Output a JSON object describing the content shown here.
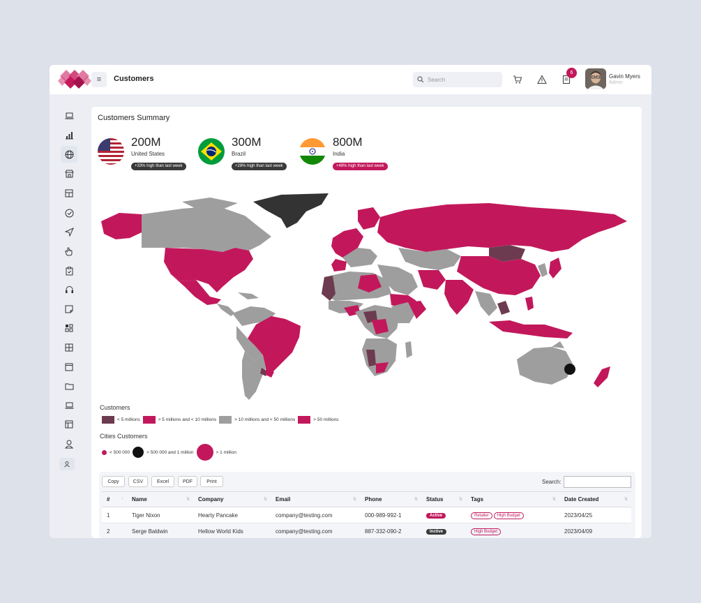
{
  "header": {
    "title": "Customers",
    "search_placeholder": "Search",
    "notification_count": "6",
    "user_name": "Gavin Myers",
    "user_role": "Admin"
  },
  "sidebar": {
    "items": [
      {
        "icon": "laptop-icon"
      },
      {
        "icon": "bar-chart-icon"
      },
      {
        "icon": "globe-icon",
        "active": true
      },
      {
        "icon": "store-icon"
      },
      {
        "icon": "calculator-icon"
      },
      {
        "icon": "check-circle-icon"
      },
      {
        "icon": "send-icon"
      },
      {
        "icon": "hand-pointer-icon"
      },
      {
        "icon": "clipboard-icon"
      },
      {
        "icon": "headphones-icon"
      },
      {
        "icon": "sticky-note-icon"
      },
      {
        "icon": "apps-icon"
      },
      {
        "icon": "grid-icon"
      },
      {
        "icon": "window-icon"
      },
      {
        "icon": "folder-icon"
      },
      {
        "icon": "laptop-icon"
      },
      {
        "icon": "layout-icon"
      },
      {
        "icon": "user-icon"
      },
      {
        "icon": "user-badge-icon"
      }
    ]
  },
  "summary": {
    "title": "Customers Summary",
    "stats": [
      {
        "value": "200M",
        "country": "United States",
        "badge": "+33% high than last week",
        "badge_color": "#3a3a3a"
      },
      {
        "value": "300M",
        "country": "Brazil",
        "badge": "+28% high than last week",
        "badge_color": "#3a3a3a"
      },
      {
        "value": "800M",
        "country": "India",
        "badge": "+48% high than last week",
        "badge_color": "#c2185b"
      }
    ]
  },
  "legend": {
    "customers_title": "Customers",
    "customers_items": [
      {
        "label": "< 5 millions",
        "color": "#6d3b4f"
      },
      {
        "label": "> 5 millions and < 10 millions",
        "color": "#c2185b"
      },
      {
        "label": "> 10 millions and < 50 millions",
        "color": "#9e9e9e"
      },
      {
        "label": "> 50 millions",
        "color": "#c2185b"
      }
    ],
    "cities_title": "Cities Customers",
    "cities_items": [
      {
        "label": "< 500 000",
        "color": "#c2185b"
      },
      {
        "label": "> 500 000 and 1 million",
        "color": "#111111"
      },
      {
        "label": "> 1 million",
        "color": "#c2185b"
      }
    ]
  },
  "table": {
    "buttons": [
      "Copy",
      "CSV",
      "Excel",
      "PDF",
      "Print"
    ],
    "search_label": "Search:",
    "columns": [
      "#",
      "Name",
      "Company",
      "Email",
      "Phone",
      "Status",
      "Tags",
      "Date Created"
    ],
    "rows": [
      {
        "num": "1",
        "name": "Tiger Nixon",
        "company": "Hearty Pancake",
        "email": "company@testing.com",
        "phone": "000-989-992-1",
        "status": "Active",
        "status_color": "#c2185b",
        "tags": [
          "Retailer",
          "High Budget"
        ],
        "date": "2023/04/25"
      },
      {
        "num": "2",
        "name": "Serge Baldwin",
        "company": "Hellow World Kids",
        "email": "company@testing.com",
        "phone": "887-332-090-2",
        "status": "Inctive",
        "status_color": "#3a3a3a",
        "tags": [
          "High Budget"
        ],
        "date": "2023/04/09"
      }
    ]
  },
  "colors": {
    "accent": "#c2185b",
    "dark_red": "#6d3b4f",
    "gray": "#9e9e9e",
    "dark": "#333333"
  }
}
